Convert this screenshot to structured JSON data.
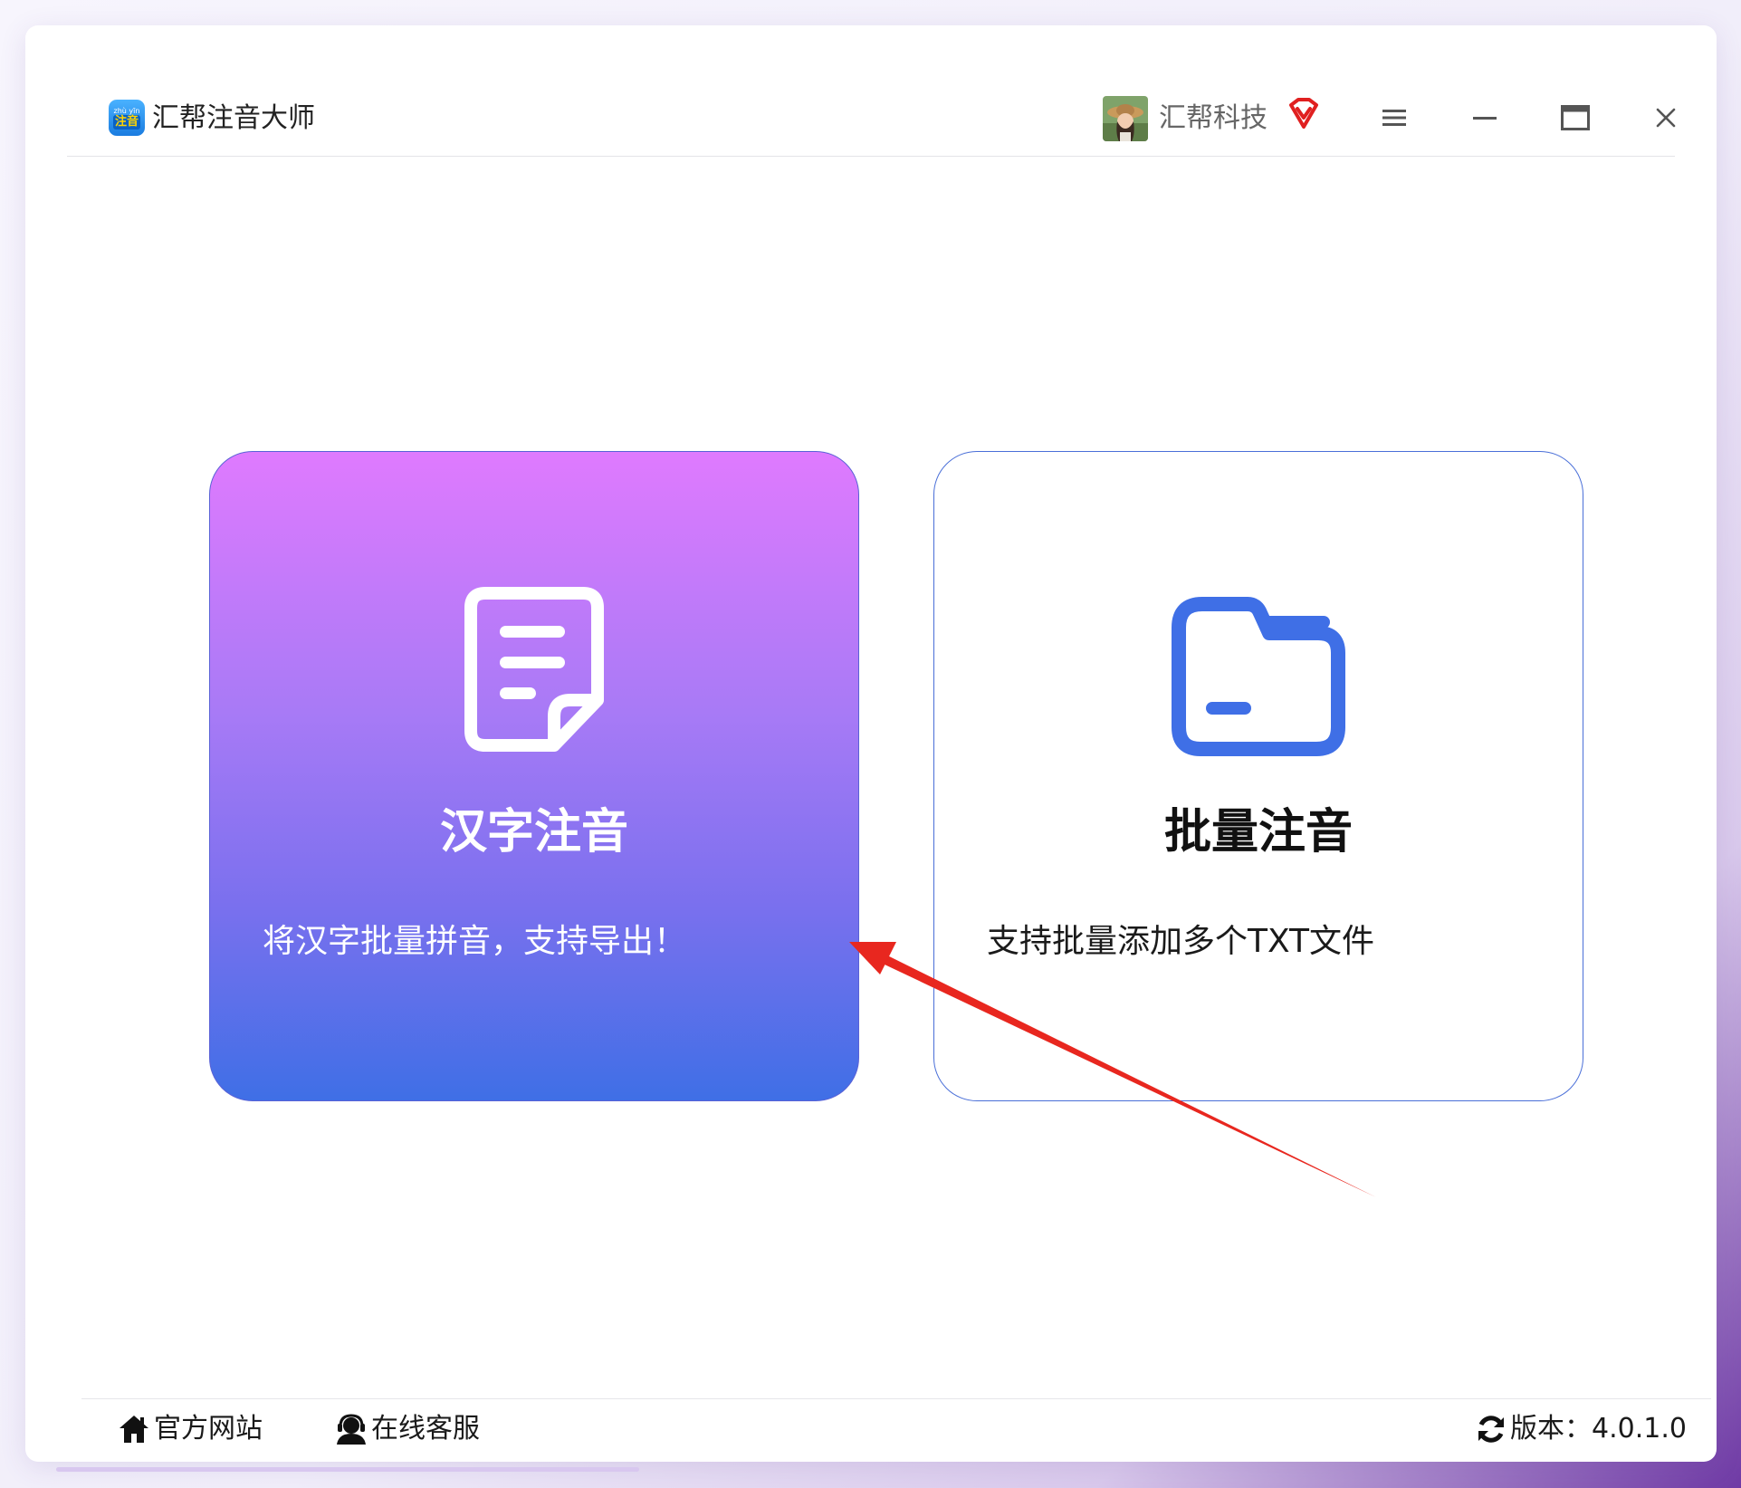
{
  "app": {
    "logo_line1": "zhù yīn",
    "logo_line2": "注音",
    "title": "汇帮注音大师"
  },
  "user": {
    "name": "汇帮科技",
    "vip_icon": "vip-diamond-icon"
  },
  "window_controls": {
    "menu_icon": "menu-icon",
    "minimize_icon": "minimize-icon",
    "maximize_icon": "maximize-icon",
    "close_icon": "close-icon"
  },
  "cards": [
    {
      "title": "汉字注音",
      "description": "将汉字批量拼音，支持导出！",
      "icon": "document-icon"
    },
    {
      "title": "批量注音",
      "description": "支持批量添加多个TXT文件",
      "icon": "folder-icon"
    }
  ],
  "footer": {
    "website_label": "官方网站",
    "support_label": "在线客服",
    "version_label": "版本：4.0.1.0"
  },
  "colors": {
    "accent_blue": "#3f6fe6",
    "gradient_top": "#df7afe",
    "arrow_red": "#e8271f"
  }
}
